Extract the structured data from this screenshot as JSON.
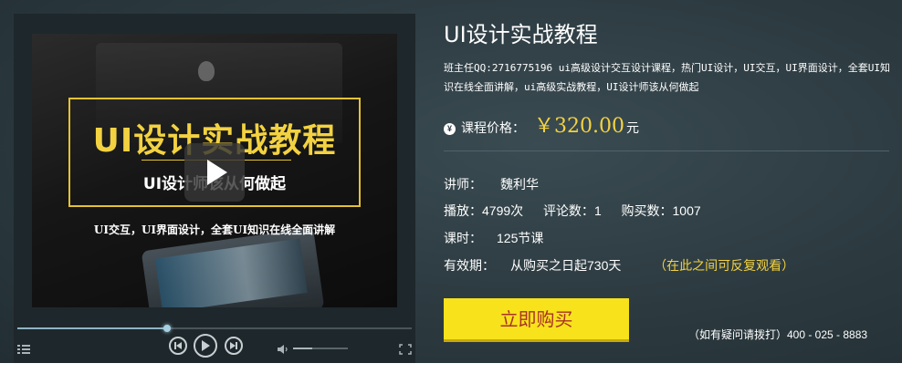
{
  "player": {
    "cover": {
      "big_title": "UI设计实战教程",
      "sub_title": "UI设计师该从何做起",
      "tagline": "UI交互，UI界面设计，全套UI知识在线全面讲解"
    },
    "progress_fraction": 0.38,
    "volume_fraction": 0.35,
    "icons": {
      "play_overlay": "play-icon",
      "prev": "previous-icon",
      "play": "play-icon",
      "next": "next-icon",
      "volume": "volume-icon",
      "playlist": "playlist-icon",
      "fullscreen": "fullscreen-icon"
    }
  },
  "course": {
    "title": "UI设计实战教程",
    "description": "班主任QQ:2716775196 ui高级设计交互设计课程，热门UI设计，UI交互，UI界面设计，全套UI知识在线全面讲解，ui高级实战教程，UI设计师该从何做起",
    "price": {
      "label": "课程价格：",
      "value": "￥320.00",
      "unit": "元"
    },
    "teacher": {
      "label": "讲师：",
      "value": "魏利华"
    },
    "stats": {
      "plays_label": "播放：",
      "plays_value": "4799次",
      "comments_label": "评论数：",
      "comments_value": "1",
      "buyers_label": "购买数：",
      "buyers_value": "1007"
    },
    "lessons": {
      "label": "课时：",
      "value": "125节课"
    },
    "validity": {
      "label": "有效期：",
      "value": "从购买之日起730天",
      "note": "（在此之间可反复观看）"
    },
    "buy_button": "立即购买",
    "hotline": "（如有疑问请拨打）400 - 025 - 8883"
  },
  "colors": {
    "accent_yellow": "#f3d241",
    "button_yellow": "#f7e21c",
    "button_text": "#a83227",
    "background": "#2c3a40"
  }
}
